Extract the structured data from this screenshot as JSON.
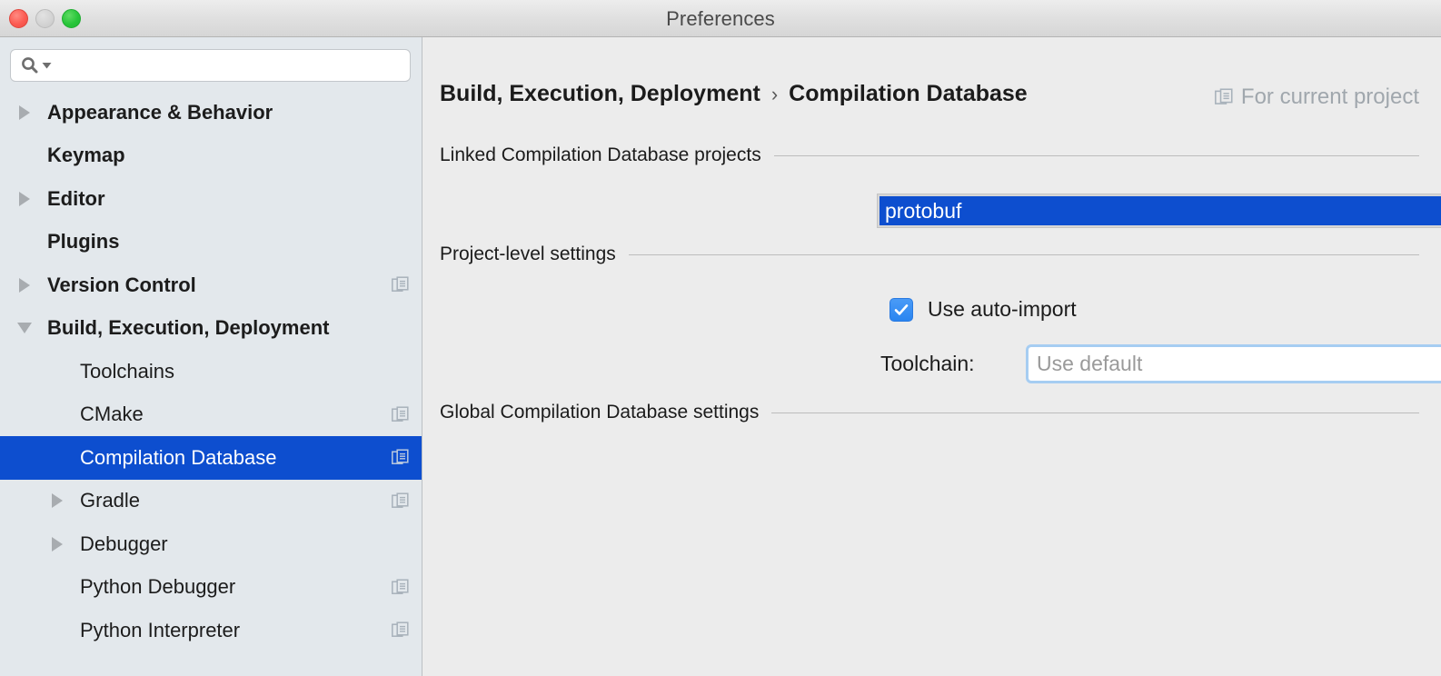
{
  "window": {
    "title": "Preferences",
    "traffic_lights": [
      "close",
      "minimize",
      "maximize"
    ]
  },
  "sidebar": {
    "search": {
      "value": "",
      "placeholder": "",
      "icon": "search-icon"
    },
    "items": [
      {
        "label": "Appearance & Behavior",
        "level": 0,
        "twisty": "right",
        "selected": false,
        "badge": false
      },
      {
        "label": "Keymap",
        "level": 0,
        "twisty": "none",
        "selected": false,
        "badge": false
      },
      {
        "label": "Editor",
        "level": 0,
        "twisty": "right",
        "selected": false,
        "badge": false
      },
      {
        "label": "Plugins",
        "level": 0,
        "twisty": "none",
        "selected": false,
        "badge": false
      },
      {
        "label": "Version Control",
        "level": 0,
        "twisty": "right",
        "selected": false,
        "badge": true
      },
      {
        "label": "Build, Execution, Deployment",
        "level": 0,
        "twisty": "down",
        "selected": false,
        "badge": false
      },
      {
        "label": "Toolchains",
        "level": 1,
        "twisty": "none",
        "selected": false,
        "badge": false
      },
      {
        "label": "CMake",
        "level": 1,
        "twisty": "none",
        "selected": false,
        "badge": true
      },
      {
        "label": "Compilation Database",
        "level": 1,
        "twisty": "none",
        "selected": true,
        "badge": true
      },
      {
        "label": "Gradle",
        "level": 1,
        "twisty": "right",
        "selected": false,
        "badge": true
      },
      {
        "label": "Debugger",
        "level": 1,
        "twisty": "right",
        "selected": false,
        "badge": false
      },
      {
        "label": "Python Debugger",
        "level": 1,
        "twisty": "none",
        "selected": false,
        "badge": true
      },
      {
        "label": "Python Interpreter",
        "level": 1,
        "twisty": "none",
        "selected": false,
        "badge": true
      }
    ]
  },
  "panel": {
    "breadcrumb": {
      "parent": "Build, Execution, Deployment",
      "separator": "›",
      "current": "Compilation Database"
    },
    "for_current_project": {
      "label": "For current project",
      "icon": "copy-project-icon"
    },
    "sections": {
      "linked_projects": "Linked Compilation Database projects",
      "project_level": "Project-level settings",
      "global_settings": "Global Compilation Database settings"
    },
    "linked_projects_list": [
      {
        "name": "protobuf",
        "selected": true
      }
    ],
    "auto_import": {
      "label": "Use auto-import",
      "checked": true
    },
    "toolchain": {
      "label": "Toolchain:",
      "value": "",
      "placeholder": "Use default",
      "stepper_icon": "up-down-chevron-icon"
    }
  },
  "colors": {
    "selection_blue": "#0d4ecf",
    "sidebar_bg": "#e3e8ec",
    "panel_bg": "#ececec",
    "checkbox_blue": "#2a85f0",
    "focus_ring": "#a6cdf2",
    "muted_text": "#a0a7ad"
  }
}
